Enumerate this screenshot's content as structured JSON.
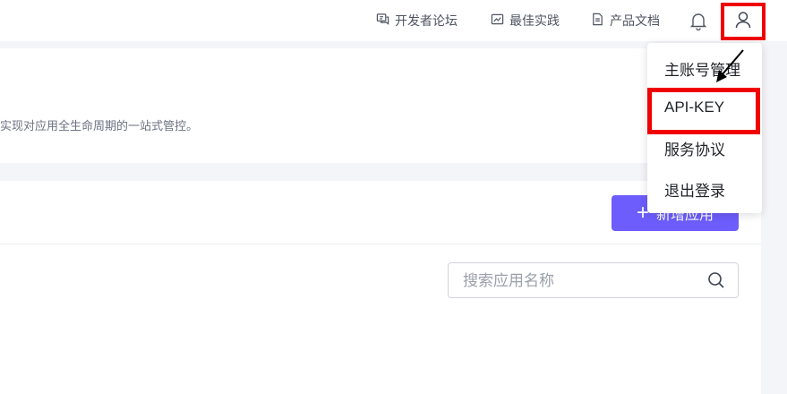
{
  "topbar": {
    "links": [
      {
        "label": "开发者论坛",
        "icon": "forum-icon"
      },
      {
        "label": "最佳实践",
        "icon": "practice-icon"
      },
      {
        "label": "产品文档",
        "icon": "document-icon"
      }
    ],
    "bell_icon": "bell-icon",
    "user_icon": "user-icon"
  },
  "main": {
    "description": "实现对应用全生命周期的一站式管控。",
    "new_app_label": "新增应用",
    "new_app_icon": "plus-icon",
    "search": {
      "placeholder": "搜索应用名称",
      "value": ""
    }
  },
  "dropdown": {
    "items": [
      {
        "label": "主账号管理"
      },
      {
        "label": "API-KEY"
      },
      {
        "label": "服务协议"
      },
      {
        "label": "退出登录"
      }
    ]
  },
  "colors": {
    "accent": "#6d5dfc",
    "annotation": "#f00000",
    "page_bg": "#f4f5f8"
  }
}
